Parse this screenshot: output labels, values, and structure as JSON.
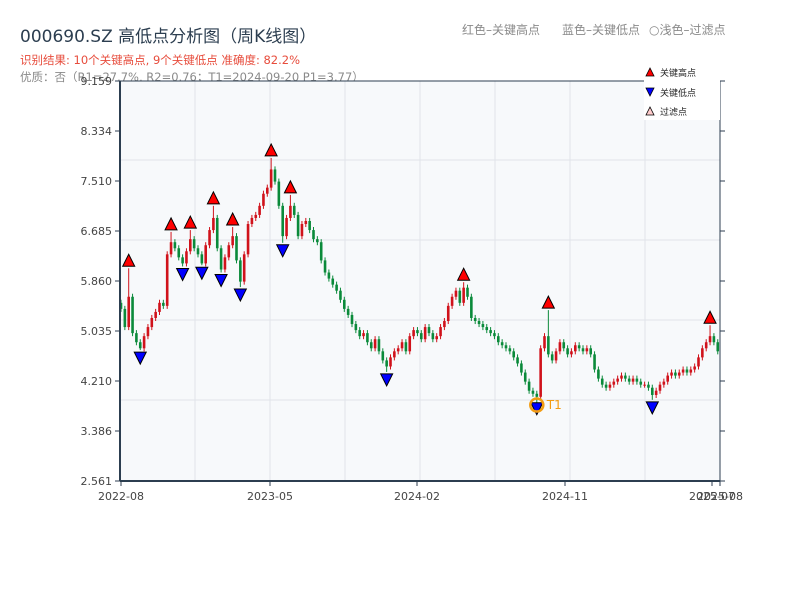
{
  "title": "000690.SZ 高低点分析图（周K线图）",
  "result_line": "识别结果: 10个关键高点, 9个关键低点  准确度: 82.2%",
  "quality_line": "优质：否（R1=27.7%, R2=0.76；T1=2024-09-20 P1=3.77）",
  "color_notes": [
    "红色–关键高点",
    "蓝色–关键低点",
    "○浅色–过滤点"
  ],
  "chart_data": {
    "type": "candlestick",
    "title": "000690.SZ 高低点分析图（周K线图）",
    "ylim": [
      2.561,
      9.159
    ],
    "y_ticks": [
      "9.159",
      "8.334",
      "7.510",
      "6.685",
      "5.860",
      "5.035",
      "4.210",
      "3.386",
      "2.561"
    ],
    "x_ticks": [
      "2022-08",
      "2023-05",
      "2024-02",
      "2024-11",
      "2025-07",
      "2025-08"
    ],
    "grid": true,
    "legend_position": "top-right",
    "legend": [
      {
        "label": "关键高点",
        "symbol": "triangle-up",
        "color": "#ff0000"
      },
      {
        "label": "关键低点",
        "symbol": "triangle-down",
        "color": "#0000ff"
      },
      {
        "label": "过滤点",
        "symbol": "triangle-up-outline",
        "color": "#ffcccc"
      }
    ],
    "colors": {
      "up": "#d0121b",
      "down": "#0a8a3a",
      "high_marker": "#ff0000",
      "low_marker": "#0000ff",
      "t1": "#f39c12"
    },
    "close": [
      5.4,
      5.1,
      5.6,
      5.0,
      4.85,
      4.75,
      4.95,
      5.1,
      5.25,
      5.35,
      5.5,
      5.45,
      6.3,
      6.5,
      6.4,
      6.25,
      6.15,
      6.35,
      6.55,
      6.4,
      6.3,
      6.15,
      6.45,
      6.7,
      6.9,
      6.4,
      6.05,
      6.25,
      6.45,
      6.6,
      6.2,
      5.85,
      6.3,
      6.8,
      6.9,
      6.95,
      7.1,
      7.3,
      7.4,
      7.7,
      7.5,
      7.1,
      6.6,
      6.9,
      7.1,
      6.95,
      6.6,
      6.8,
      6.85,
      6.7,
      6.55,
      6.5,
      6.2,
      6.0,
      5.9,
      5.8,
      5.7,
      5.55,
      5.4,
      5.3,
      5.15,
      5.05,
      4.95,
      5.0,
      4.85,
      4.75,
      4.9,
      4.7,
      4.55,
      4.45,
      4.6,
      4.7,
      4.75,
      4.85,
      4.7,
      4.95,
      5.05,
      5.0,
      4.9,
      5.1,
      5.0,
      4.9,
      4.95,
      5.1,
      5.2,
      5.45,
      5.6,
      5.7,
      5.5,
      5.75,
      5.6,
      5.25,
      5.2,
      5.15,
      5.1,
      5.05,
      5.0,
      4.95,
      4.85,
      4.8,
      4.75,
      4.7,
      4.6,
      4.5,
      4.35,
      4.2,
      4.05,
      4.0,
      3.95,
      4.75,
      4.95,
      4.65,
      4.55,
      4.7,
      4.85,
      4.75,
      4.65,
      4.7,
      4.8,
      4.75,
      4.7,
      4.75,
      4.65,
      4.4,
      4.25,
      4.15,
      4.1,
      4.15,
      4.2,
      4.25,
      4.3,
      4.25,
      4.2,
      4.25,
      4.2,
      4.15,
      4.15,
      4.1,
      3.98,
      4.05,
      4.15,
      4.2,
      4.3,
      4.35,
      4.3,
      4.35,
      4.4,
      4.35,
      4.4,
      4.45,
      4.6,
      4.75,
      4.85,
      4.95,
      4.85,
      4.7
    ],
    "key_highs": [
      {
        "week": 2,
        "price": 6.07
      },
      {
        "week": 13,
        "price": 6.67
      },
      {
        "week": 18,
        "price": 6.7
      },
      {
        "week": 24,
        "price": 7.1
      },
      {
        "week": 29,
        "price": 6.75
      },
      {
        "week": 39,
        "price": 7.89
      },
      {
        "week": 44,
        "price": 7.28
      },
      {
        "week": 89,
        "price": 5.84
      },
      {
        "week": 111,
        "price": 5.38
      },
      {
        "week": 153,
        "price": 5.13
      }
    ],
    "key_lows": [
      {
        "week": 5,
        "price": 4.72
      },
      {
        "week": 16,
        "price": 6.1
      },
      {
        "week": 21,
        "price": 6.12
      },
      {
        "week": 26,
        "price": 6.0
      },
      {
        "week": 31,
        "price": 5.76
      },
      {
        "week": 42,
        "price": 6.49
      },
      {
        "week": 69,
        "price": 4.36
      },
      {
        "week": 108,
        "price": 3.77
      },
      {
        "week": 138,
        "price": 3.9
      }
    ],
    "t1": {
      "label": "T1",
      "week": 108,
      "date": "2024-09-20",
      "price": 3.77
    }
  }
}
